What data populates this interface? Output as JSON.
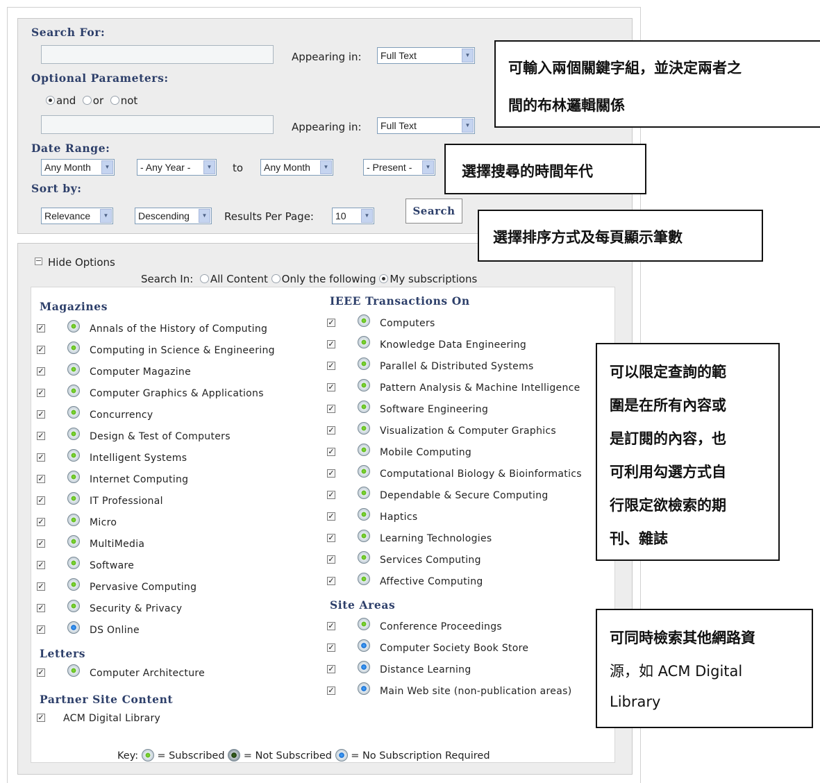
{
  "search": {
    "search_for": "Search For:",
    "appearing_in": "Appearing in:",
    "field1_value": "Full Text",
    "optional_params": "Optional Parameters:",
    "bool_and": "and",
    "bool_or": "or",
    "bool_not": "not",
    "field2_value": "Full Text",
    "date_range": "Date Range:",
    "from_month": "Any Month",
    "from_year": "- Any Year -",
    "to": "to",
    "to_month": "Any Month",
    "to_year": "- Present -",
    "sort_by": "Sort by:",
    "sort_field": "Relevance",
    "sort_order": "Descending",
    "results_per_page": "Results Per Page:",
    "per_page_value": "10",
    "search_button": "Search"
  },
  "options": {
    "hide_options": "Hide Options",
    "search_in": "Search In:",
    "all_content": "All Content",
    "only_following": "Only the following",
    "my_subscriptions": "My subscriptions",
    "magazines_heading": "Magazines",
    "magazines": [
      "Annals of the History of Computing",
      "Computing in Science & Engineering",
      "Computer Magazine",
      "Computer Graphics & Applications",
      "Concurrency",
      "Design & Test of Computers",
      "Intelligent Systems",
      "Internet Computing",
      "IT Professional",
      "Micro",
      "MultiMedia",
      "Software",
      "Pervasive Computing",
      "Security & Privacy",
      "DS Online"
    ],
    "letters_heading": "Letters",
    "letters": [
      "Computer Architecture"
    ],
    "partner_heading": "Partner Site Content",
    "partner": [
      "ACM Digital Library"
    ],
    "transactions_heading": "IEEE Transactions On",
    "transactions": [
      "Computers",
      "Knowledge Data Engineering",
      "Parallel & Distributed Systems",
      "Pattern Analysis & Machine Intelligence",
      "Software Engineering",
      "Visualization & Computer Graphics",
      "Mobile Computing",
      "Computational Biology & Bioinformatics",
      "Dependable & Secure Computing",
      "Haptics",
      "Learning Technologies",
      "Services Computing",
      "Affective Computing"
    ],
    "site_areas_heading": "Site Areas",
    "site_areas": [
      "Conference Proceedings",
      "Computer Society Book Store",
      "Distance Learning",
      "Main Web site (non-publication areas)"
    ],
    "key_label": "Key:",
    "key_subscribed": "= Subscribed",
    "key_not_subscribed": "= Not Subscribed",
    "key_no_subscription": "= No Subscription Required"
  },
  "callouts": {
    "c1": [
      "可輸入兩個關鍵字組，並決定兩者之",
      "間的布林邏輯關係"
    ],
    "c2": [
      "選擇搜尋的時間年代"
    ],
    "c3": [
      "選擇排序方式及每頁顯示筆數"
    ],
    "c4": [
      "可以限定查詢的範",
      "圍是在所有內容或",
      "是訂閱的內容，也",
      "可利用勾選方式自",
      "行限定欲檢索的期",
      "刊、雜誌"
    ],
    "c5": [
      "可同時檢索其他網路資",
      "源，如  ACM Digital",
      "Library"
    ]
  }
}
